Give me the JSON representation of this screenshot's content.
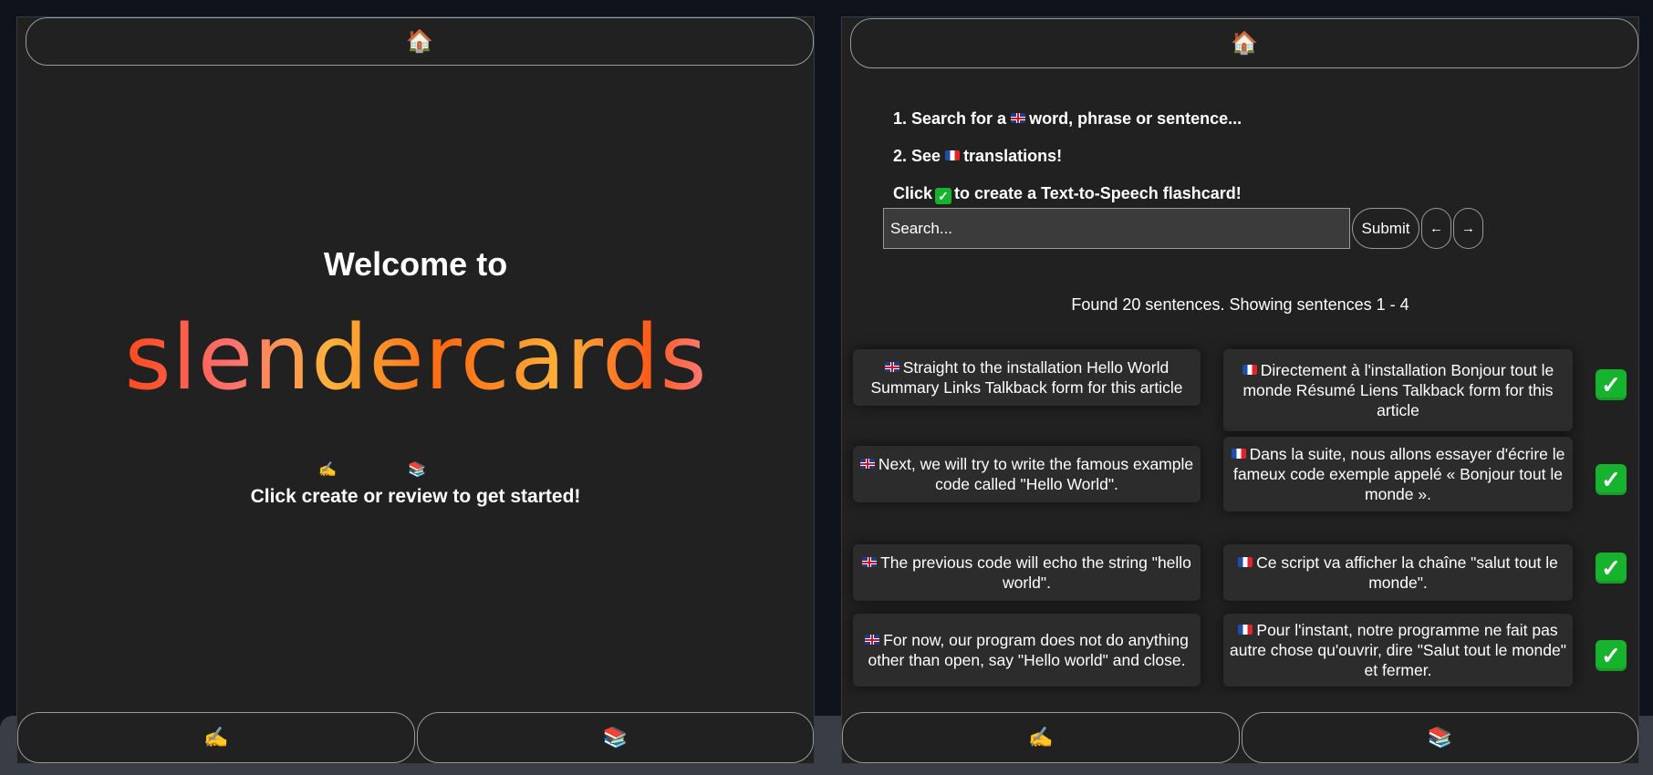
{
  "icons": {
    "home": "🏠",
    "create": "✍️",
    "review": "📚",
    "check": "✅"
  },
  "left": {
    "welcome": "Welcome to",
    "brand": "slendercards",
    "cta": "Click create or review to get started!"
  },
  "right": {
    "step1_prefix": "1. Search for a",
    "step1_suffix": "word, phrase or sentence...",
    "step2_prefix": "2. See",
    "step2_suffix": "translations!",
    "step3_prefix": "Click",
    "step3_suffix": "to create a Text-to-Speech flashcard!",
    "search_placeholder": "Search...",
    "submit_label": "Submit",
    "prev_label": "←",
    "next_label": "→",
    "found_text": "Found 20 sentences. Showing sentences 1 - 4",
    "results": [
      {
        "en": "Straight to the installation Hello World Summary Links Talkback form for this article",
        "fr": "Directement à l'installation Bonjour tout le monde Résumé Liens Talkback form for this article"
      },
      {
        "en": "Next, we will try to write the famous example code called \"Hello World\".",
        "fr": "Dans la suite, nous allons essayer d'écrire le fameux code exemple appelé « Bonjour tout le monde »."
      },
      {
        "en": "The previous code will echo the string \"hello world\".",
        "fr": "Ce script va afficher la chaîne \"salut tout le monde\"."
      },
      {
        "en": "For now, our program does not do anything other than open, say \"Hello world\" and close.",
        "fr": "Pour l'instant, notre programme ne fait pas autre chose qu'ouvrir, dire \"Salut tout le monde\" et fermer."
      }
    ]
  },
  "colors": {
    "panel_bg": "#212121",
    "page_bg": "#0f141c",
    "card_bg": "#2c2c2c",
    "check_green": "#18b32e",
    "brand_gradient": [
      "#ff4a1c",
      "#ff6a6a",
      "#ffae3b",
      "#ff7a1a"
    ]
  }
}
